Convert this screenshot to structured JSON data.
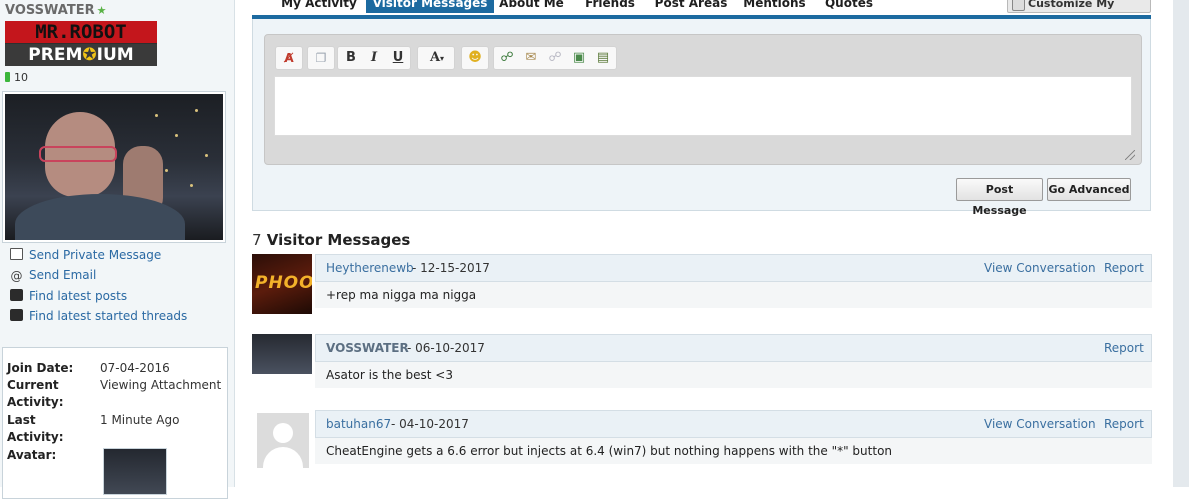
{
  "profile": {
    "username": "VOSSWATER",
    "rank_top": "MR.ROBOT",
    "rank_bottom_left": "PREM",
    "rank_bottom_right": "IUM",
    "reputation": "10"
  },
  "sidebar_links": [
    {
      "label": "Send Private Message",
      "icon": "mail-icon"
    },
    {
      "label": "Send Email",
      "icon": "at-icon"
    },
    {
      "label": "Find latest posts",
      "icon": "posts-icon"
    },
    {
      "label": "Find latest started threads",
      "icon": "threads-icon"
    }
  ],
  "info": {
    "join_date_label": "Join Date:",
    "join_date_value": "07-04-2016",
    "current_label_1": "Current",
    "current_label_2": "Activity:",
    "current_value": "Viewing Attachment",
    "last_label_1": "Last",
    "last_label_2": "Activity:",
    "last_value": "1 Minute Ago",
    "avatar_label": "Avatar:"
  },
  "tabs": [
    "My Activity",
    "Visitor Messages",
    "About Me",
    "Friends",
    "Post Areas",
    "Mentions",
    "Quotes"
  ],
  "active_tab": "Visitor Messages",
  "customize_label": "Customize My Profile",
  "editor": {
    "textarea_value": "",
    "post_button": "Post Message",
    "advanced_button": "Go Advanced",
    "toolbar_icons": [
      "remove-format-icon",
      "paste-icon",
      "bold-icon",
      "italic-icon",
      "underline-icon",
      "font-size-icon",
      "smiley-icon",
      "link-icon",
      "email-link-icon",
      "unlink-icon",
      "image-icon",
      "video-icon"
    ],
    "bold_glyph": "B",
    "italic_glyph": "I",
    "underline_glyph": "U",
    "font_glyph": "A"
  },
  "messages_header": {
    "count": "7",
    "title": "Visitor Messages"
  },
  "messages": [
    {
      "author": "Heytherenewb",
      "date": "12-15-2017",
      "view": "View Conversation",
      "report": "Report",
      "text": "+rep ma nigga ma nigga",
      "thumb_text": "PHOON"
    },
    {
      "author": "VOSSWATER",
      "date": "06-10-2017",
      "view": "",
      "report": "Report",
      "text": "Asator is the best <3",
      "thumb_text": ""
    },
    {
      "author": "batuhan67",
      "date": "04-10-2017",
      "view": "View Conversation",
      "report": "Report",
      "text": "CheatEngine gets a 6.6 error but injects at 6.4 (win7) but nothing happens with the \"*\" button",
      "thumb_text": ""
    }
  ],
  "colors": {
    "accent": "#1c6aa0",
    "link": "#3a6fa0",
    "header_bg": "#eaf1f6"
  }
}
